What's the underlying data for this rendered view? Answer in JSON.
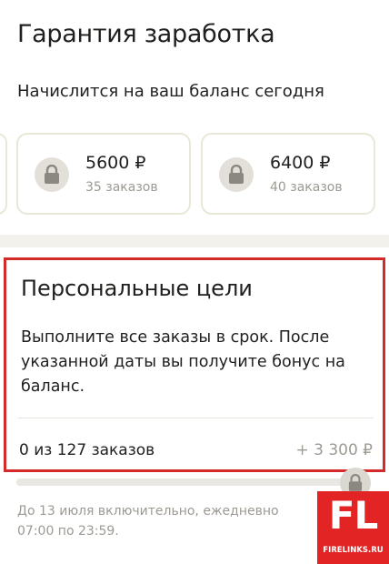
{
  "header": {
    "title": "Гарантия заработка",
    "subtitle": "Начислится на ваш баланс сегодня"
  },
  "cards": [
    {
      "amount": "5600 ₽",
      "orders": "35 заказов",
      "icon": "lock-icon"
    },
    {
      "amount": "6400 ₽",
      "orders": "40 заказов",
      "icon": "lock-icon"
    }
  ],
  "goals": {
    "title": "Персональные цели",
    "description": "Выполните все заказы в срок. После указанной даты вы получите бонус на баланс.",
    "progress_text": "0 из 127 заказов",
    "bonus": "+ 3 300 ₽",
    "progress_fraction": 0
  },
  "footnote": {
    "line1": "До 13 июля включительно, ежедневно",
    "line2": "07:00 по 23:59."
  },
  "watermark": {
    "big": "FL",
    "small": "FIRELINKS.RU"
  },
  "colors": {
    "highlight_border": "#d42a2a",
    "card_border": "#e9e7d6",
    "muted_text": "#9c9a93",
    "watermark_bg": "#e32424"
  }
}
